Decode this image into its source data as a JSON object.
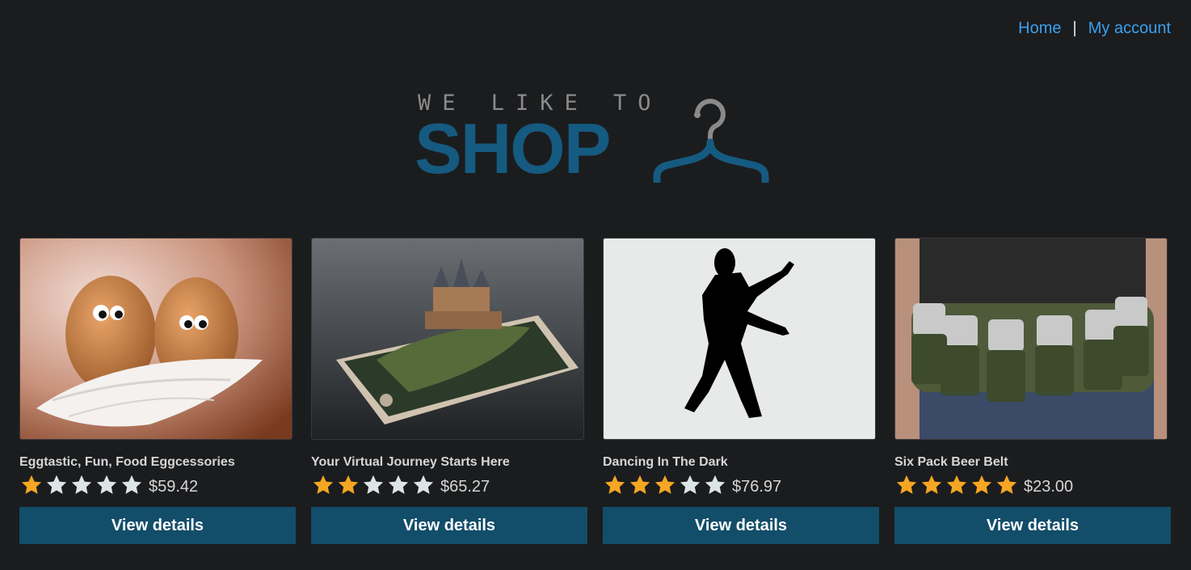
{
  "nav": {
    "home": "Home",
    "separator": "|",
    "account": "My account"
  },
  "logo": {
    "tagline": "WE LIKE TO",
    "word": "SHOP",
    "icon": "hanger-icon"
  },
  "colors": {
    "background": "#1b1c1e",
    "link": "#3aa0ef",
    "brand": "#155a80",
    "button": "#124d6a",
    "star_filled": "#f5a623",
    "star_empty": "#dde4e8"
  },
  "products": [
    {
      "name": "Eggtastic, Fun, Food Eggcessories",
      "rating": 1,
      "price": "$59.42",
      "button": "View details"
    },
    {
      "name": "Your Virtual Journey Starts Here",
      "rating": 2,
      "price": "$65.27",
      "button": "View details"
    },
    {
      "name": "Dancing In The Dark",
      "rating": 3,
      "price": "$76.97",
      "button": "View details"
    },
    {
      "name": "Six Pack Beer Belt",
      "rating": 5,
      "price": "$23.00",
      "button": "View details"
    }
  ]
}
